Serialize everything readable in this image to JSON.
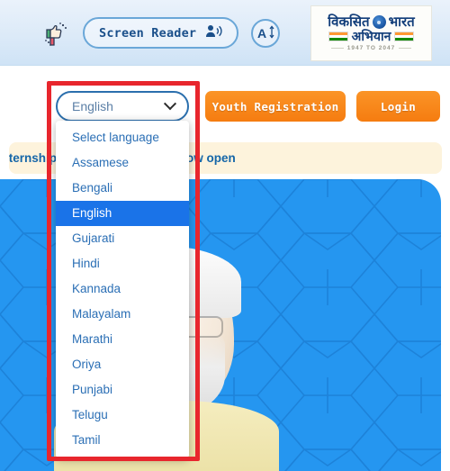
{
  "topbar": {
    "accessibility_icon": "thumbs-up-down-icon",
    "screen_reader_label": "Screen Reader",
    "screen_reader_icon": "speaker-person-icon",
    "font_size_label": "A",
    "font_size_icon": "font-size-icon",
    "logo": {
      "line1": "विकसित",
      "line1b": "भारत",
      "line2": "अभियान",
      "years": "1947 TO 2047",
      "flag_icon": "tricolour-flag-icon",
      "chakra_icon": "ashoka-chakra-icon"
    }
  },
  "nav": {
    "language_select": {
      "value": "English",
      "chevron_icon": "chevron-down-icon"
    },
    "youth_registration_label": "Youth Registration",
    "login_label": "Login"
  },
  "notice": {
    "text": "The internship application round is now open"
  },
  "language_dropdown": {
    "selected": "English",
    "items": [
      "Select language",
      "Assamese",
      "Bengali",
      "English",
      "Gujarati",
      "Hindi",
      "Kannada",
      "Malayalam",
      "Marathi",
      "Oriya",
      "Punjabi",
      "Telugu",
      "Tamil"
    ]
  },
  "hero": {
    "background_color": "#2596f0",
    "person_alt": "portrait-photo"
  },
  "annotation": {
    "shape": "rectangle",
    "color": "#e8262d"
  },
  "colors": {
    "accent_orange": "#f57c10",
    "accent_blue": "#1a73e8",
    "hero_blue": "#2596f0",
    "notice_cream": "#fdf3dc",
    "topbar_blue": "#dceaf8",
    "annotation_red": "#e8262d"
  }
}
